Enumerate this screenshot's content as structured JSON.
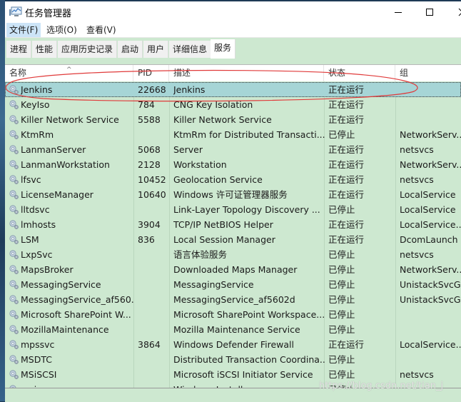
{
  "window": {
    "title": "任务管理器",
    "controls": {
      "minimize": "—",
      "maximize": "☐",
      "close": "✕"
    }
  },
  "menu": [
    "文件(F)",
    "选项(O)",
    "查看(V)"
  ],
  "tabs": [
    {
      "label": "进程",
      "selected": false
    },
    {
      "label": "性能",
      "selected": false
    },
    {
      "label": "应用历史记录",
      "selected": false
    },
    {
      "label": "启动",
      "selected": false
    },
    {
      "label": "用户",
      "selected": false
    },
    {
      "label": "详细信息",
      "selected": false
    },
    {
      "label": "服务",
      "selected": true
    }
  ],
  "table": {
    "columns": [
      "名称",
      "PID",
      "描述",
      "状态",
      "组"
    ],
    "sort_indicator": "^",
    "rows": [
      {
        "name": "Jenkins",
        "pid": "22668",
        "desc": "Jenkins",
        "status": "正在运行",
        "group": "",
        "selected": true
      },
      {
        "name": "KeyIso",
        "pid": "784",
        "desc": "CNG Key Isolation",
        "status": "正在运行",
        "group": ""
      },
      {
        "name": "Killer Network Service",
        "pid": "5588",
        "desc": "Killer Network Service",
        "status": "正在运行",
        "group": ""
      },
      {
        "name": "KtmRm",
        "pid": "",
        "desc": "KtmRm for Distributed Transacti...",
        "status": "已停止",
        "group": "NetworkServ..."
      },
      {
        "name": "LanmanServer",
        "pid": "5068",
        "desc": "Server",
        "status": "正在运行",
        "group": "netsvcs"
      },
      {
        "name": "LanmanWorkstation",
        "pid": "2128",
        "desc": "Workstation",
        "status": "正在运行",
        "group": "NetworkServ..."
      },
      {
        "name": "lfsvc",
        "pid": "10452",
        "desc": "Geolocation Service",
        "status": "正在运行",
        "group": "netsvcs"
      },
      {
        "name": "LicenseManager",
        "pid": "10640",
        "desc": "Windows 许可证管理器服务",
        "status": "正在运行",
        "group": "LocalService"
      },
      {
        "name": "lltdsvc",
        "pid": "",
        "desc": "Link-Layer Topology Discovery ...",
        "status": "已停止",
        "group": "LocalService"
      },
      {
        "name": "lmhosts",
        "pid": "3904",
        "desc": "TCP/IP NetBIOS Helper",
        "status": "正在运行",
        "group": "LocalService..."
      },
      {
        "name": "LSM",
        "pid": "836",
        "desc": "Local Session Manager",
        "status": "正在运行",
        "group": "DcomLaunch"
      },
      {
        "name": "LxpSvc",
        "pid": "",
        "desc": "语言体验服务",
        "status": "已停止",
        "group": "netsvcs"
      },
      {
        "name": "MapsBroker",
        "pid": "",
        "desc": "Downloaded Maps Manager",
        "status": "已停止",
        "group": "NetworkServ..."
      },
      {
        "name": "MessagingService",
        "pid": "",
        "desc": "MessagingService",
        "status": "已停止",
        "group": "UnistackSvcG..."
      },
      {
        "name": "MessagingService_af560...",
        "pid": "",
        "desc": "MessagingService_af5602d",
        "status": "已停止",
        "group": "UnistackSvcG..."
      },
      {
        "name": "Microsoft SharePoint W...",
        "pid": "",
        "desc": "Microsoft SharePoint Workspace...",
        "status": "已停止",
        "group": ""
      },
      {
        "name": "MozillaMaintenance",
        "pid": "",
        "desc": "Mozilla Maintenance Service",
        "status": "已停止",
        "group": ""
      },
      {
        "name": "mpssvc",
        "pid": "3864",
        "desc": "Windows Defender Firewall",
        "status": "正在运行",
        "group": "LocalService..."
      },
      {
        "name": "MSDTC",
        "pid": "",
        "desc": "Distributed Transaction Coordina...",
        "status": "已停止",
        "group": ""
      },
      {
        "name": "MSiSCSI",
        "pid": "",
        "desc": "Microsoft iSCSI Initiator Service",
        "status": "已停止",
        "group": "netsvcs"
      },
      {
        "name": "msiserver",
        "pid": "",
        "desc": "Windows Installer",
        "status": "已停止",
        "group": ""
      }
    ]
  },
  "watermark": "https://blog.csdn.net/tian_j",
  "colors": {
    "content_bg": "#cde8d0",
    "selected_row": "#a6d5d6",
    "annotation_ellipse": "#e03a3a"
  }
}
